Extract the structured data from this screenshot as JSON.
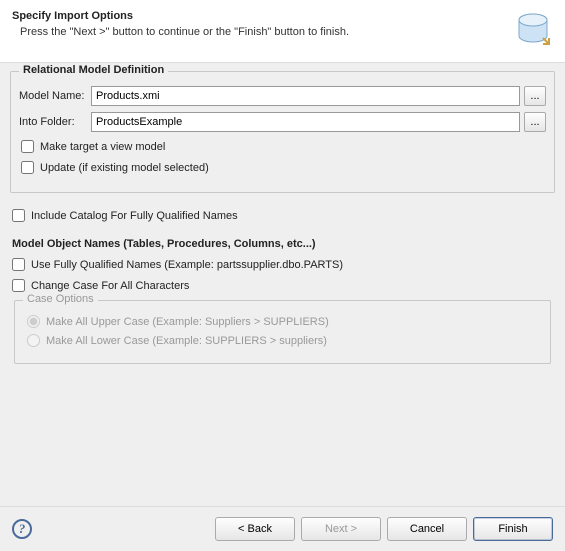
{
  "header": {
    "title": "Specify Import Options",
    "subtitle": "Press the \"Next >\" button to continue or the \"Finish\" button to finish."
  },
  "relational": {
    "legend": "Relational Model Definition",
    "modelNameLabel": "Model Name:",
    "modelName": "Products.xmi",
    "intoFolderLabel": "Into Folder:",
    "intoFolder": "ProductsExample",
    "makeViewLabel": "Make target a view model",
    "updateLabel": "Update (if existing model selected)"
  },
  "catalog": {
    "includeCatalogLabel": "Include Catalog For Fully Qualified Names"
  },
  "modelObjectNames": {
    "legend": "Model Object Names (Tables, Procedures, Columns, etc...)",
    "useFqnLabel": "Use Fully Qualified Names  (Example: partssupplier.dbo.PARTS)",
    "changeCaseLabel": "Change Case For All Characters",
    "caseFieldsetLegend": "Case Options",
    "upperLabel": "Make All Upper Case  (Example: Suppliers > SUPPLIERS)",
    "lowerLabel": "Make All Lower Case  (Example: SUPPLIERS > suppliers)"
  },
  "footer": {
    "back": "< Back",
    "next": "Next >",
    "cancel": "Cancel",
    "finish": "Finish"
  }
}
